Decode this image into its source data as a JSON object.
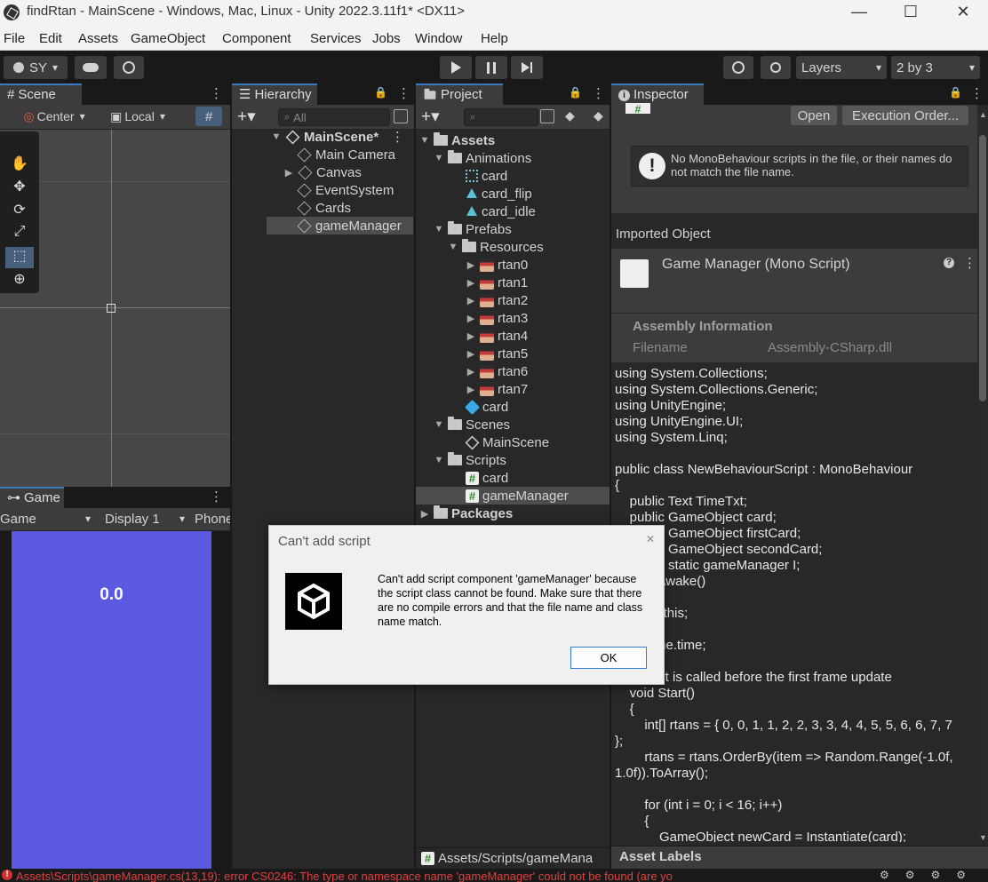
{
  "window": {
    "title": "findRtan - MainScene - Windows, Mac, Linux - Unity 2022.3.11f1* <DX11>",
    "minimize": "—",
    "maximize": "☐",
    "close": "✕"
  },
  "menu": [
    "File",
    "Edit",
    "Assets",
    "GameObject",
    "Component",
    "Services",
    "Jobs",
    "Window",
    "Help"
  ],
  "toolbar": {
    "account": "SY",
    "layers": "Layers",
    "layout": "2 by 3"
  },
  "scene": {
    "tab": "Scene",
    "pivot": "Center",
    "space": "Local"
  },
  "game": {
    "tab": "Game",
    "mode": "Game",
    "display": "Display 1",
    "aspect": "Phone",
    "time_text": "0.0",
    "bg_color": "#5a59e0"
  },
  "hierarchy": {
    "tab": "Hierarchy",
    "search_placeholder": "All",
    "scene": "MainScene*",
    "items": [
      "Main Camera",
      "Canvas",
      "EventSystem",
      "Cards",
      "gameManager"
    ]
  },
  "project": {
    "tab": "Project",
    "assets": "Assets",
    "animations": "Animations",
    "anim_items": [
      "card",
      "card_flip",
      "card_idle"
    ],
    "prefabs": "Prefabs",
    "resources": "Resources",
    "rtans": [
      "rtan0",
      "rtan1",
      "rtan2",
      "rtan3",
      "rtan4",
      "rtan5",
      "rtan6",
      "rtan7"
    ],
    "prefab_card": "card",
    "scenes": "Scenes",
    "scene_item": "MainScene",
    "scripts": "Scripts",
    "script_items": [
      "card",
      "gameManager"
    ],
    "packages": "Packages",
    "path": "Assets/Scripts/gameMana"
  },
  "inspector": {
    "tab": "Inspector",
    "open": "Open",
    "execution_order": "Execution Order...",
    "warning": "No MonoBehaviour scripts in the file, or their names do not match the file name.",
    "imported_object": "Imported Object",
    "script_title": "Game Manager (Mono Script)",
    "assembly_info": "Assembly Information",
    "filename_label": "Filename",
    "filename_value": "Assembly-CSharp.dll",
    "asset_labels": "Asset Labels",
    "code": [
      "using System.Collections;",
      "using System.Collections.Generic;",
      "using UnityEngine;",
      "using UnityEngine.UI;",
      "using System.Linq;",
      "",
      "public class NewBehaviourScript : MonoBehaviour",
      "{",
      "    public Text TimeTxt;",
      "    public GameObject card;",
      "    public GameObject firstCard;",
      "    public GameObject secondCard;",
      "    public static gameManager I;",
      "    void Awake()",
      "",
      "        I = this;",
      "",
      "        Time.time;",
      "",
      "    // Start is called before the first frame update",
      "    void Start()",
      "    {",
      "        int[] rtans = { 0, 0, 1, 1, 2, 2, 3, 3, 4, 4, 5, 5, 6, 6, 7, 7",
      "};",
      "        rtans = rtans.OrderBy(item => Random.Range(-1.0f,",
      "1.0f)).ToArray();",
      "",
      "        for (int i = 0; i < 16; i++)",
      "        {",
      "            GameObject newCard = Instantiate(card);"
    ]
  },
  "dialog": {
    "title": "Can't add script",
    "close": "✕",
    "message": "Can't add script component 'gameManager' because the script class cannot be found. Make sure that there are no compile errors and that the file name and class name match.",
    "ok": "OK"
  },
  "status": {
    "error": "Assets\\Scripts\\gameManager.cs(13,19): error CS0246: The type or namespace name 'gameManager' could not be found (are yo"
  }
}
